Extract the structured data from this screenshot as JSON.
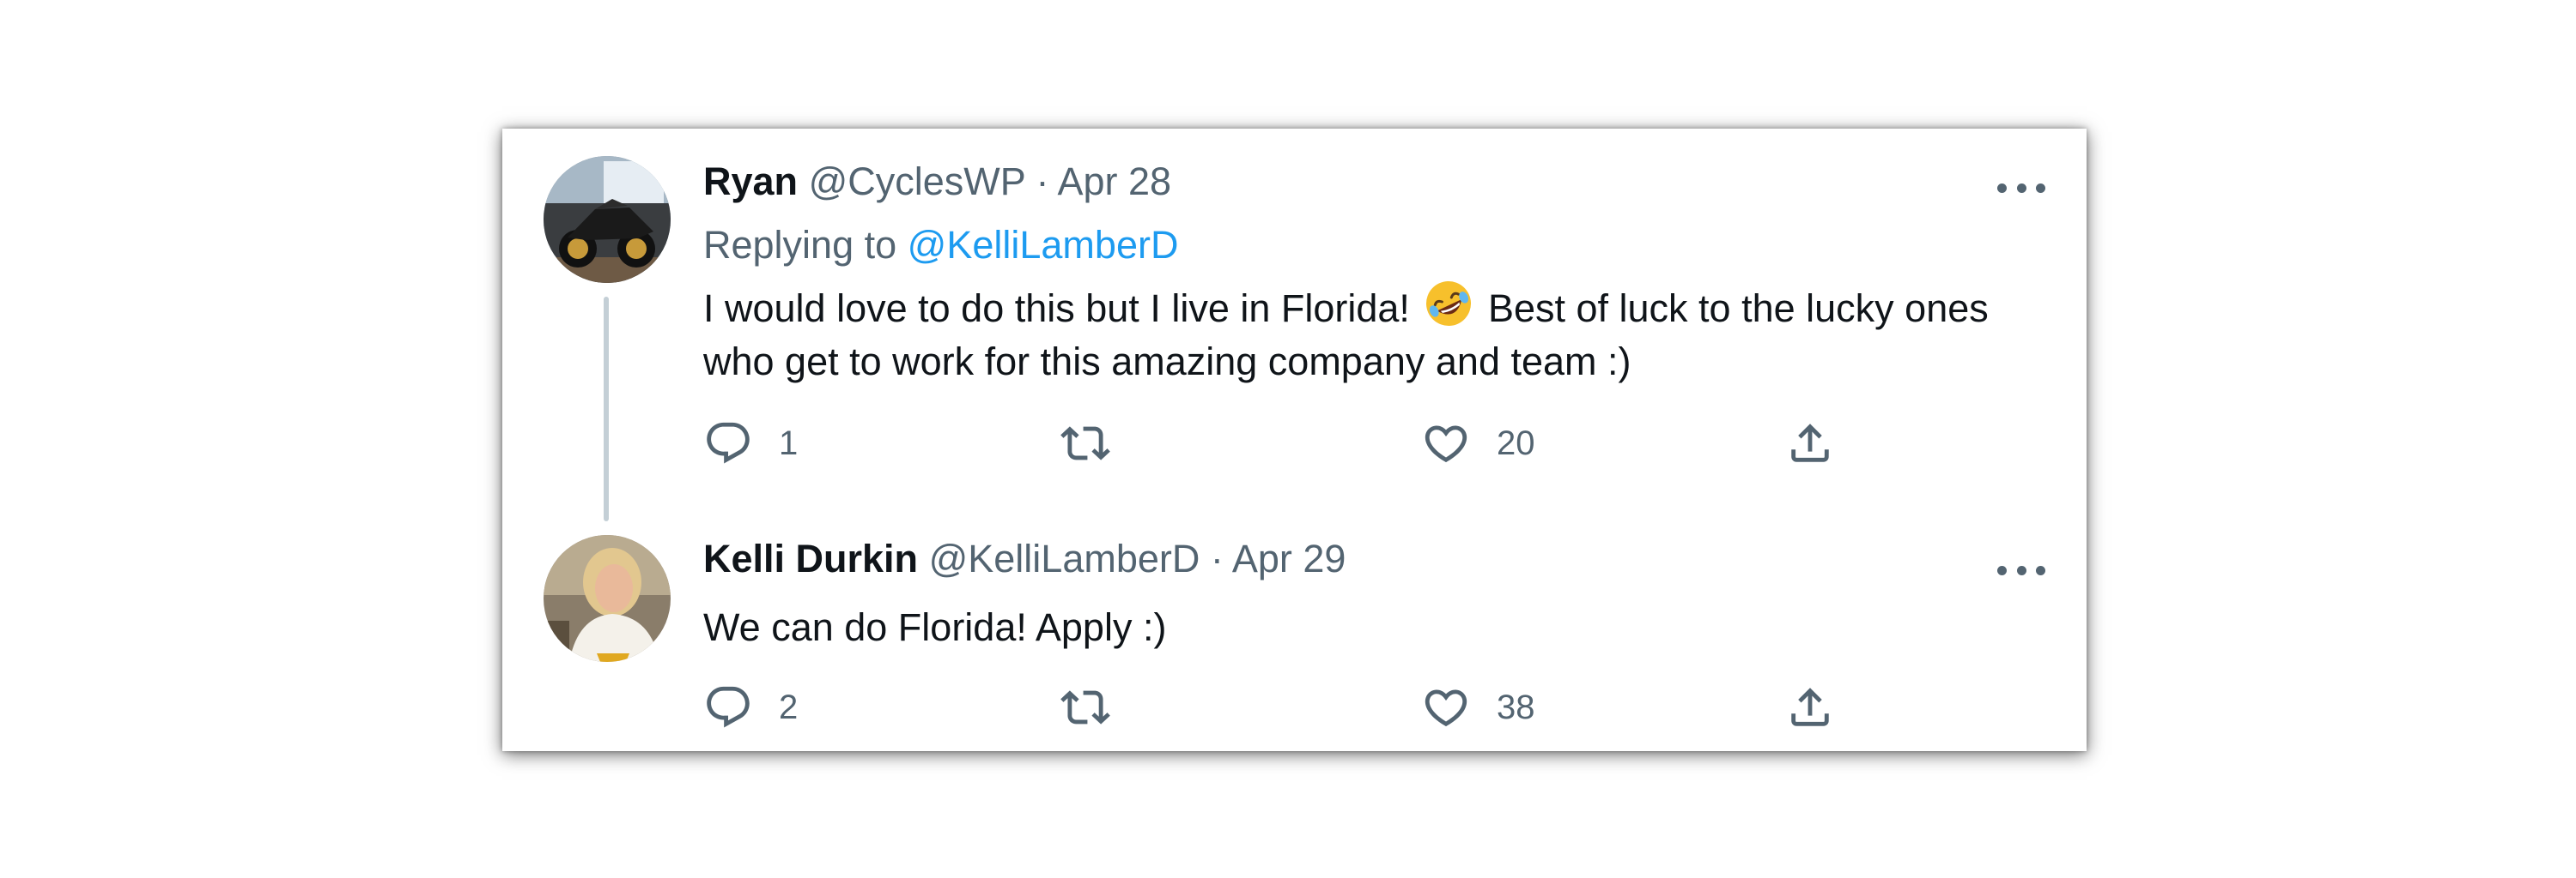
{
  "tweets": [
    {
      "name": "Ryan",
      "meta": "@CyclesWP · Apr 28",
      "replying_prefix": "Replying to",
      "replying_to": "@KelliLamberD",
      "text_before_emoji": "I would love to do this but I live in Florida!",
      "emoji": "rolling-on-the-floor-laughing",
      "text_after_emoji": "Best of luck to the lucky ones who get to work for this amazing company and team :)",
      "replies": "1",
      "likes": "20"
    },
    {
      "name": "Kelli Durkin",
      "meta": "@KelliLamberD · Apr 29",
      "text": "We can do Florida! Apply :)",
      "replies": "2",
      "likes": "38"
    }
  ],
  "icons": [
    "reply-icon",
    "retweet-icon",
    "like-icon",
    "share-icon",
    "more-options-icon"
  ],
  "colors": {
    "text_primary": "#0f1419",
    "text_secondary": "#536471",
    "link": "#1d9bf0",
    "thread_line": "#c4cfd6"
  }
}
